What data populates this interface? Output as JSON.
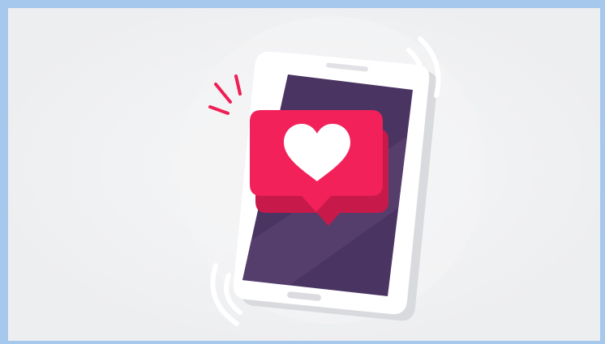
{
  "illustration": {
    "subject": "smartphone-like-notification",
    "icons": [
      "smartphone-icon",
      "heart-icon",
      "like-notification-bubble-icon",
      "vibration-waves-icon",
      "sparkle-lines-icon"
    ],
    "colors": {
      "frame_border": "#a6c8ec",
      "background": "#edeef0",
      "background_glow": "#f6f7f8",
      "phone_body": "#ffffff",
      "phone_screen": "#4a3461",
      "phone_screen_shine": "#58416f",
      "phone_shadow": "#d9dadd",
      "speaker_slot": "#e2e2e6",
      "home_button": "#dcdce0",
      "bubble": "#f2215a",
      "bubble_shadow": "#c81a4a",
      "heart": "#ffffff",
      "waves": "#ffffff",
      "sparkles": "#ef1f55"
    }
  }
}
